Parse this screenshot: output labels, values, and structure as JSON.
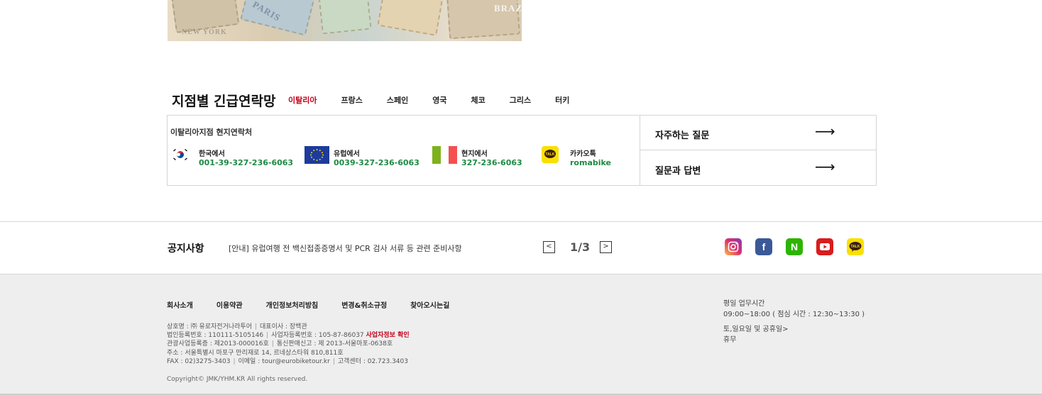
{
  "banner": {
    "words": [
      "PARIS",
      "BRAZIL",
      "NEW YORK"
    ]
  },
  "emergency": {
    "title": "지점별 긴급연락망",
    "tabs": [
      {
        "label": "이탈리아",
        "active": true
      },
      {
        "label": "프랑스",
        "active": false
      },
      {
        "label": "스페인",
        "active": false
      },
      {
        "label": "영국",
        "active": false
      },
      {
        "label": "체코",
        "active": false
      },
      {
        "label": "그리스",
        "active": false
      },
      {
        "label": "터키",
        "active": false
      }
    ],
    "subtitle": "이탈리아지점 현지연락처",
    "contacts": [
      {
        "icon": "korea-flag-icon",
        "label": "한국에서",
        "number": "001-39-327-236-6063"
      },
      {
        "icon": "eu-flag-icon",
        "label": "유럽에서",
        "number": "0039-327-236-6063"
      },
      {
        "icon": "italy-flag-icon",
        "label": "현지에서",
        "number": "327-236-6063"
      },
      {
        "icon": "kakaotalk-icon",
        "label": "카카오톡",
        "number": "romabike"
      }
    ],
    "links": [
      {
        "label": "자주하는 질문",
        "arrow": "⟶"
      },
      {
        "label": "질문과 답변",
        "arrow": "⟶"
      }
    ]
  },
  "notice": {
    "title": "공지사항",
    "text": "[안내] 유럽여행 전 백신접종증명서 및 PCR 검사 서류 등 관련 준비사항",
    "pagination": "1/3",
    "prev": "<",
    "next": ">",
    "social": [
      "instagram-icon",
      "facebook-icon",
      "naver-icon",
      "youtube-icon",
      "kakaotalk-icon"
    ],
    "social_glyphs": {
      "facebook": "f",
      "naver": "N",
      "youtube": "▶",
      "kakaotalk": "TALK"
    }
  },
  "footer": {
    "menu": [
      "회사소개",
      "이용약관",
      "개인정보처리방침",
      "변경&취소규정",
      "찾아오시는길"
    ],
    "info": {
      "line1a": "상호명 : ㈜ 유로자전거나라투어",
      "line1b": "대표이사 : 장백관",
      "line2a": "법인등록번호 : 110111-5105146",
      "line2b": "사업자등록번호 : 105-87-86037",
      "line2c": "사업자정보 확인",
      "line3a": "관광사업등록증 : 제2013-000016호",
      "line3b": "통신판매신고 : 제 2013-서울마포-0638호",
      "line4": "주소 : 서울특별시 마포구 만리재로 14, 르네상스타워 810,811호",
      "line5a": "FAX : 02)3275-3403",
      "line5b": "이메일 : tour@eurobiketour.kr",
      "line5c": "고객센터 : 02.723.3403"
    },
    "copyright": "Copyright© JMK/YHM.KR All rights reserved.",
    "hours": {
      "title": "평일 업무시간",
      "weekday": "09:00~18:00 ( 점심 시간 : 12:30~13:30 )",
      "weekend_title": "토,일요일 및 공휴일>",
      "weekend": "휴무"
    }
  },
  "colors": {
    "accent_red": "#c4001a",
    "phone_green": "#1e8a44",
    "footer_bg": "#eeeeee"
  }
}
